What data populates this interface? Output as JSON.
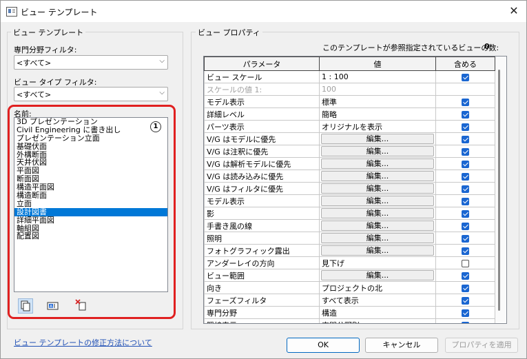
{
  "window": {
    "title": "ビュー テンプレート",
    "close_glyph": "✕"
  },
  "left": {
    "group_title": "ビュー テンプレート",
    "discipline_label": "専門分野フィルタ:",
    "discipline_value": "<すべて>",
    "viewtype_label": "ビュー タイプ フィルタ:",
    "viewtype_value": "<すべて>",
    "names_label": "名前:",
    "names": [
      "3D プレゼンテーション",
      "Civil Engineering に書き出し",
      "プレゼンテーション立面",
      "基礎伏面",
      "外構断面",
      "天井伏図",
      "平面図",
      "断面図",
      "構造平面図",
      "構造断面",
      "立面",
      "設計図書",
      "詳細平面図",
      "軸組図",
      "配置図"
    ],
    "selected_index": 11,
    "callout": "1",
    "icons": [
      "duplicate-icon",
      "rename-icon",
      "delete-icon"
    ],
    "help_link": "ビュー テンプレートの修正方法について"
  },
  "right": {
    "group_title": "ビュー プロパティ",
    "count_label": "このテンプレートが参照指定されているビューの数:",
    "count_value": "0",
    "headers": {
      "param": "パラメータ",
      "value": "値",
      "include": "含める"
    },
    "edit_label": "編集...",
    "rows": [
      {
        "param": "ビュー スケール",
        "value": "1 : 100",
        "edit": false,
        "include": true,
        "dim": false
      },
      {
        "param": "スケールの値   1:",
        "value": "100",
        "edit": false,
        "include": null,
        "dim": true
      },
      {
        "param": "モデル表示",
        "value": "標準",
        "edit": false,
        "include": true,
        "dim": false
      },
      {
        "param": "詳細レベル",
        "value": "簡略",
        "edit": false,
        "include": true,
        "dim": false
      },
      {
        "param": "パーツ表示",
        "value": "オリジナルを表示",
        "edit": false,
        "include": true,
        "dim": false
      },
      {
        "param": "V/G はモデルに優先",
        "value": "",
        "edit": true,
        "include": true,
        "dim": false
      },
      {
        "param": "V/G は注釈に優先",
        "value": "",
        "edit": true,
        "include": true,
        "dim": false
      },
      {
        "param": "V/G は解析モデルに優先",
        "value": "",
        "edit": true,
        "include": true,
        "dim": false
      },
      {
        "param": "V/G は読み込みに優先",
        "value": "",
        "edit": true,
        "include": true,
        "dim": false
      },
      {
        "param": "V/G はフィルタに優先",
        "value": "",
        "edit": true,
        "include": true,
        "dim": false
      },
      {
        "param": "モデル表示",
        "value": "",
        "edit": true,
        "include": true,
        "dim": false
      },
      {
        "param": "影",
        "value": "",
        "edit": true,
        "include": true,
        "dim": false
      },
      {
        "param": "手書き風の線",
        "value": "",
        "edit": true,
        "include": true,
        "dim": false
      },
      {
        "param": "照明",
        "value": "",
        "edit": true,
        "include": true,
        "dim": false
      },
      {
        "param": "フォトグラフィック露出",
        "value": "",
        "edit": true,
        "include": true,
        "dim": false
      },
      {
        "param": "アンダーレイの方向",
        "value": "見下げ",
        "edit": false,
        "include": false,
        "dim": false
      },
      {
        "param": "ビュー範囲",
        "value": "",
        "edit": true,
        "include": true,
        "dim": false
      },
      {
        "param": "向き",
        "value": "プロジェクトの北",
        "edit": false,
        "include": true,
        "dim": false
      },
      {
        "param": "フェーズフィルタ",
        "value": "すべて表示",
        "edit": false,
        "include": true,
        "dim": false
      },
      {
        "param": "専門分野",
        "value": "構造",
        "edit": false,
        "include": true,
        "dim": false
      },
      {
        "param": "隠線表示",
        "value": "専門分野別",
        "edit": false,
        "include": true,
        "dim": false
      }
    ]
  },
  "buttons": {
    "ok": "OK",
    "cancel": "キャンセル",
    "apply": "プロパティを適用"
  }
}
